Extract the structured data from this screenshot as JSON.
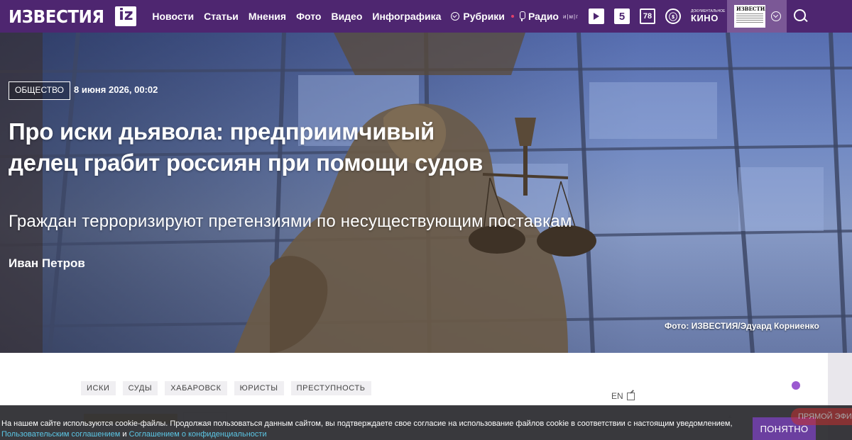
{
  "header": {
    "logo_text": "ИЗВЕСТИЯ",
    "logo_badge": "iz",
    "nav": [
      "Новости",
      "Статьи",
      "Мнения",
      "Фото",
      "Видео",
      "Инфографика"
    ],
    "rubriki_label": "Рубрики",
    "radio_label": "Радио",
    "radio_sub": "и|м|г",
    "channels": [
      "5",
      "78"
    ],
    "kino_small": "ДОКУМЕНТАЛЬНОЕ",
    "kino_label": "КИНО",
    "newspaper_label": "ИЗВЕСТИЯ"
  },
  "article": {
    "category": "Общество",
    "date": "8 июня 2026, 00:02",
    "title": "Про иски дьявола: предприимчивый делец грабит россиян при помощи судов",
    "subtitle": "Граждан терроризируют претензиями по несуществующим поставкам",
    "author": "Иван Петров",
    "photo_credit": "Фото: ИЗВЕСТИЯ/Эдуард Корниенко",
    "tags": [
      "ИСКИ",
      "СУДЫ",
      "ХАБАРОВСК",
      "ЮРИСТЫ",
      "ПРЕСТУПНОСТЬ"
    ],
    "en_link": "EN"
  },
  "cookie": {
    "text_before": "На нашем сайте используются cookie-файлы. Продолжая пользоваться данным сайтом, вы подтверждаете свое согласие на использование файлов cookie в соответствии с настоящим уведомлением, ",
    "link1": "Пользовательским соглашением",
    "and": " и ",
    "link2": "Соглашением о конфиденциальности",
    "button": "ПОНЯТНО"
  },
  "live_label": "ПРЯМОЙ ЭФИР",
  "colors": {
    "brand": "#4e2670",
    "accent_button": "#6b3fa0",
    "link": "#5cc7e6"
  }
}
